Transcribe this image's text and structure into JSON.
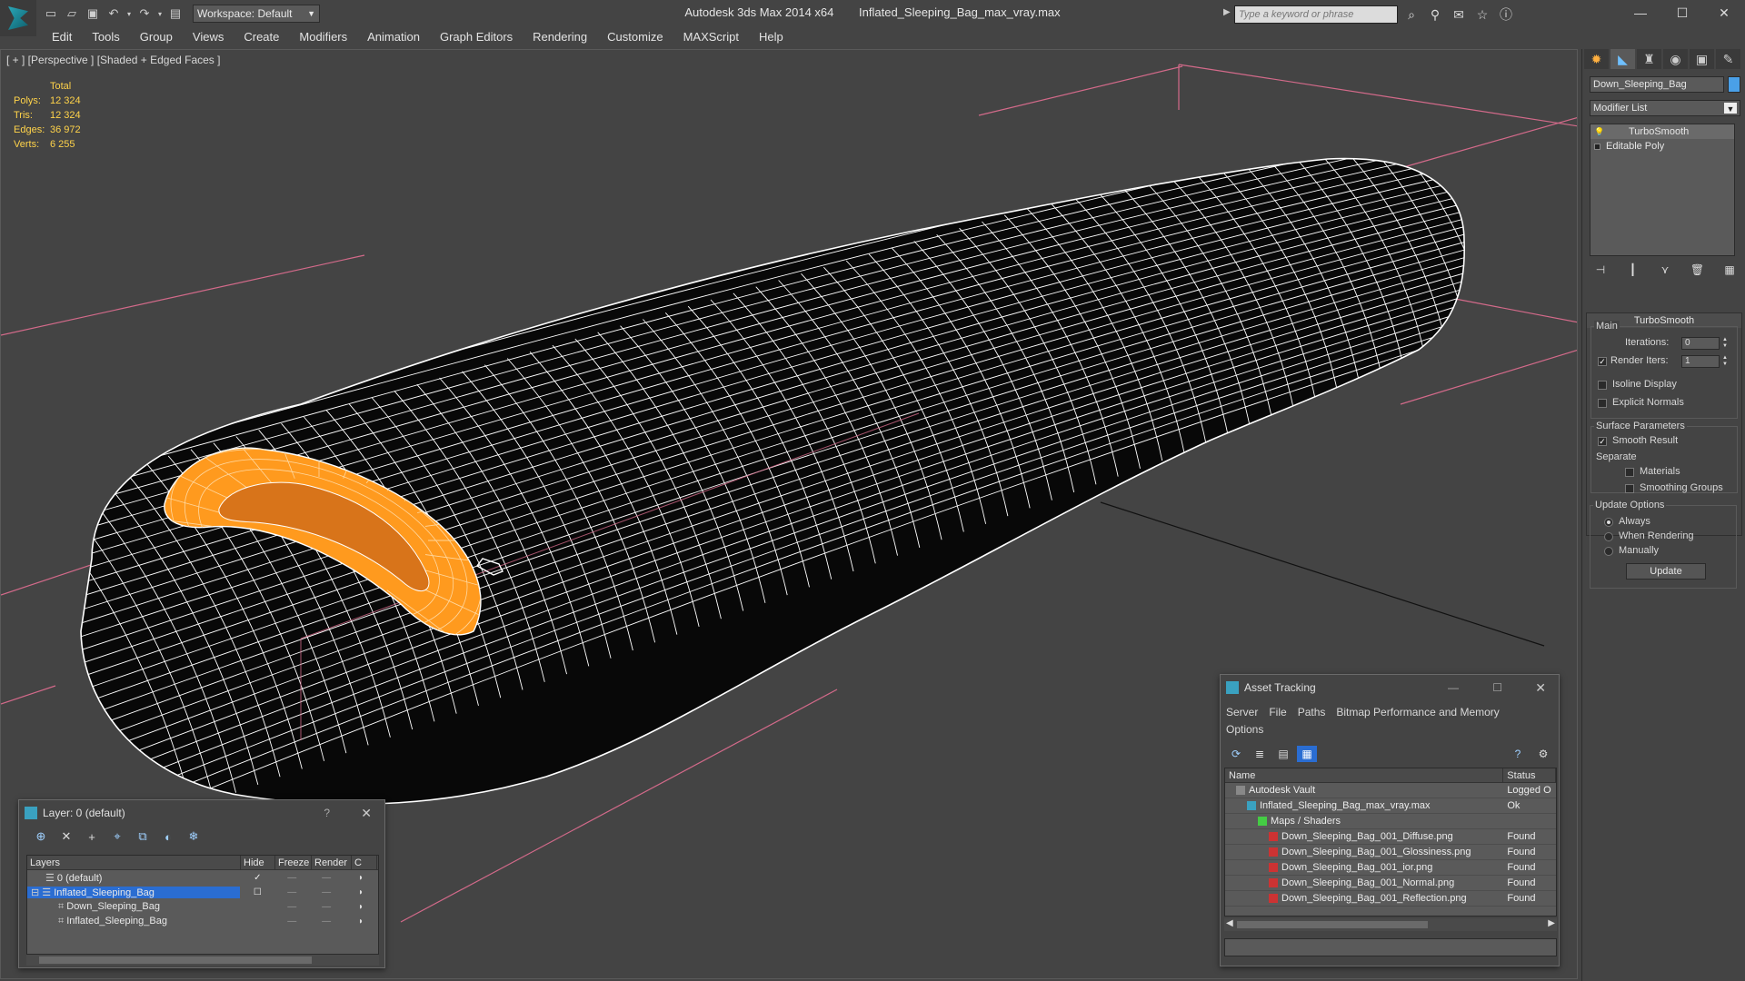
{
  "titlebar": {
    "app_name": "Autodesk 3ds Max  2014 x64",
    "file_name": "Inflated_Sleeping_Bag_max_vray.max",
    "workspace": "Workspace: Default",
    "search_placeholder": "Type a keyword or phrase"
  },
  "menu": [
    "Edit",
    "Tools",
    "Group",
    "Views",
    "Create",
    "Modifiers",
    "Animation",
    "Graph Editors",
    "Rendering",
    "Customize",
    "MAXScript",
    "Help"
  ],
  "viewport": {
    "label": "[ + ] [Perspective ] [Shaded + Edged Faces ]",
    "stats": {
      "header": "Total",
      "rows": [
        {
          "k": "Polys:",
          "v": "12 324"
        },
        {
          "k": "Tris:",
          "v": "12 324"
        },
        {
          "k": "Edges:",
          "v": "36 972"
        },
        {
          "k": "Verts:",
          "v": "6 255"
        }
      ]
    }
  },
  "command_panel": {
    "object_name": "Down_Sleeping_Bag",
    "object_color": "#4aa0e8",
    "modifier_list": "Modifier List",
    "stack": [
      {
        "label": "TurboSmooth",
        "selected": true
      },
      {
        "label": "Editable Poly",
        "selected": false
      }
    ],
    "rollout_title": "TurboSmooth",
    "main_group": "Main",
    "iterations_label": "Iterations:",
    "iterations_value": "0",
    "render_iters_label": "Render Iters:",
    "render_iters_value": "1",
    "isoline_label": "Isoline Display",
    "explicit_label": "Explicit Normals",
    "surface_group": "Surface Parameters",
    "smooth_label": "Smooth Result",
    "separate_label": "Separate",
    "materials_label": "Materials",
    "smoothing_label": "Smoothing Groups",
    "update_group": "Update Options",
    "always_label": "Always",
    "when_rendering_label": "When Rendering",
    "manually_label": "Manually",
    "update_button": "Update"
  },
  "layer_dialog": {
    "title": "Layer: 0 (default)",
    "help": "?",
    "columns": [
      "Layers",
      "Hide",
      "Freeze",
      "Render",
      "C"
    ],
    "rows": [
      {
        "name": "0 (default)",
        "indent": 1,
        "selected": false
      },
      {
        "name": "Inflated_Sleeping_Bag",
        "indent": 0,
        "selected": true
      },
      {
        "name": "Down_Sleeping_Bag",
        "indent": 2,
        "selected": false
      },
      {
        "name": "Inflated_Sleeping_Bag",
        "indent": 2,
        "selected": false
      }
    ]
  },
  "asset_dialog": {
    "title": "Asset Tracking",
    "menu": [
      "Server",
      "File",
      "Paths",
      "Bitmap Performance and Memory",
      "Options"
    ],
    "columns": [
      "Name",
      "Status"
    ],
    "rows": [
      {
        "name": "Autodesk Vault",
        "status": "Logged O",
        "indent": 1,
        "icon": "vault-icon"
      },
      {
        "name": "Inflated_Sleeping_Bag_max_vray.max",
        "status": "Ok",
        "indent": 2,
        "icon": "max-file-icon"
      },
      {
        "name": "Maps / Shaders",
        "status": "",
        "indent": 3,
        "icon": "maps-icon"
      },
      {
        "name": "Down_Sleeping_Bag_001_Diffuse.png",
        "status": "Found",
        "indent": 4,
        "icon": "png-icon"
      },
      {
        "name": "Down_Sleeping_Bag_001_Glossiness.png",
        "status": "Found",
        "indent": 4,
        "icon": "png-icon"
      },
      {
        "name": "Down_Sleeping_Bag_001_ior.png",
        "status": "Found",
        "indent": 4,
        "icon": "png-icon"
      },
      {
        "name": "Down_Sleeping_Bag_001_Normal.png",
        "status": "Found",
        "indent": 4,
        "icon": "png-icon"
      },
      {
        "name": "Down_Sleeping_Bag_001_Reflection.png",
        "status": "Found",
        "indent": 4,
        "icon": "png-icon"
      }
    ]
  },
  "colors": {
    "selection": "#2a6dd2",
    "stats_text": "#ffd34a",
    "grid_line": "#d36a8a",
    "mesh_dark": "#080808",
    "mesh_wire": "#ffffff",
    "hood_orange": "#ff9a1e"
  }
}
